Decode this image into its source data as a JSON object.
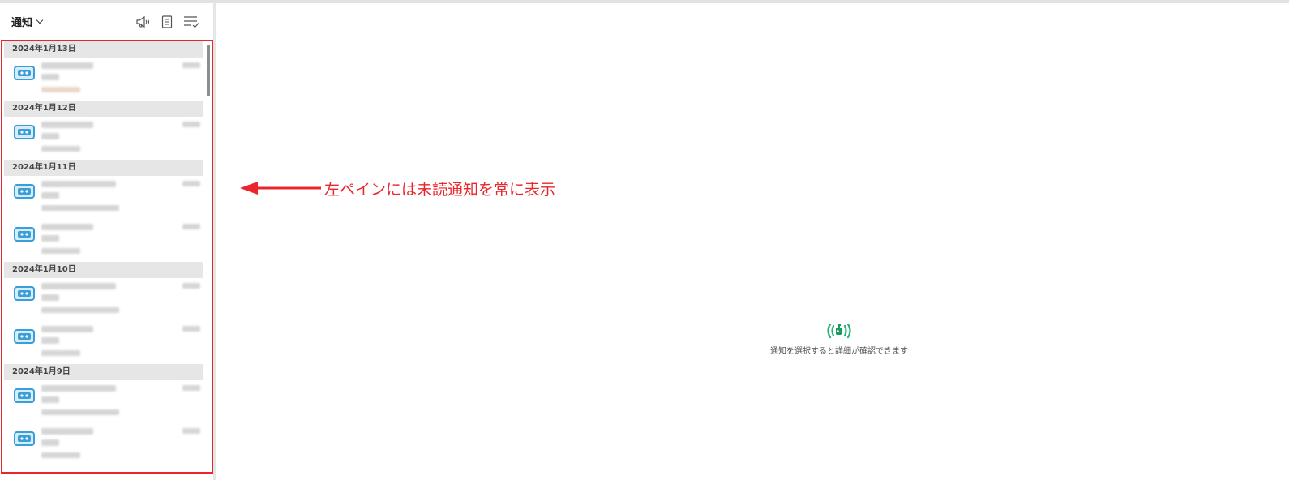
{
  "header": {
    "title": "通知",
    "icons": [
      "megaphone-icon",
      "document-icon",
      "checklist-icon"
    ]
  },
  "groups": [
    {
      "date": "2024年1月13日",
      "items": [
        {
          "icon": "bot-icon"
        }
      ]
    },
    {
      "date": "2024年1月12日",
      "items": [
        {
          "icon": "bot-icon"
        }
      ]
    },
    {
      "date": "2024年1月11日",
      "items": [
        {
          "icon": "bot-icon"
        },
        {
          "icon": "bot-icon"
        }
      ]
    },
    {
      "date": "2024年1月10日",
      "items": [
        {
          "icon": "bot-icon"
        },
        {
          "icon": "bot-icon"
        }
      ]
    },
    {
      "date": "2024年1月9日",
      "items": [
        {
          "icon": "bot-icon"
        },
        {
          "icon": "bot-icon"
        }
      ]
    }
  ],
  "annotation": {
    "text": "左ペインには未読通知を常に表示",
    "color": "#e8262b"
  },
  "empty_state": {
    "message": "通知を選択すると詳細が確認できます",
    "icon": "broadcast-icon",
    "accent": "#22b573"
  },
  "colors": {
    "bot_icon": "#3a9fd8",
    "highlight_border": "#e8262b"
  }
}
